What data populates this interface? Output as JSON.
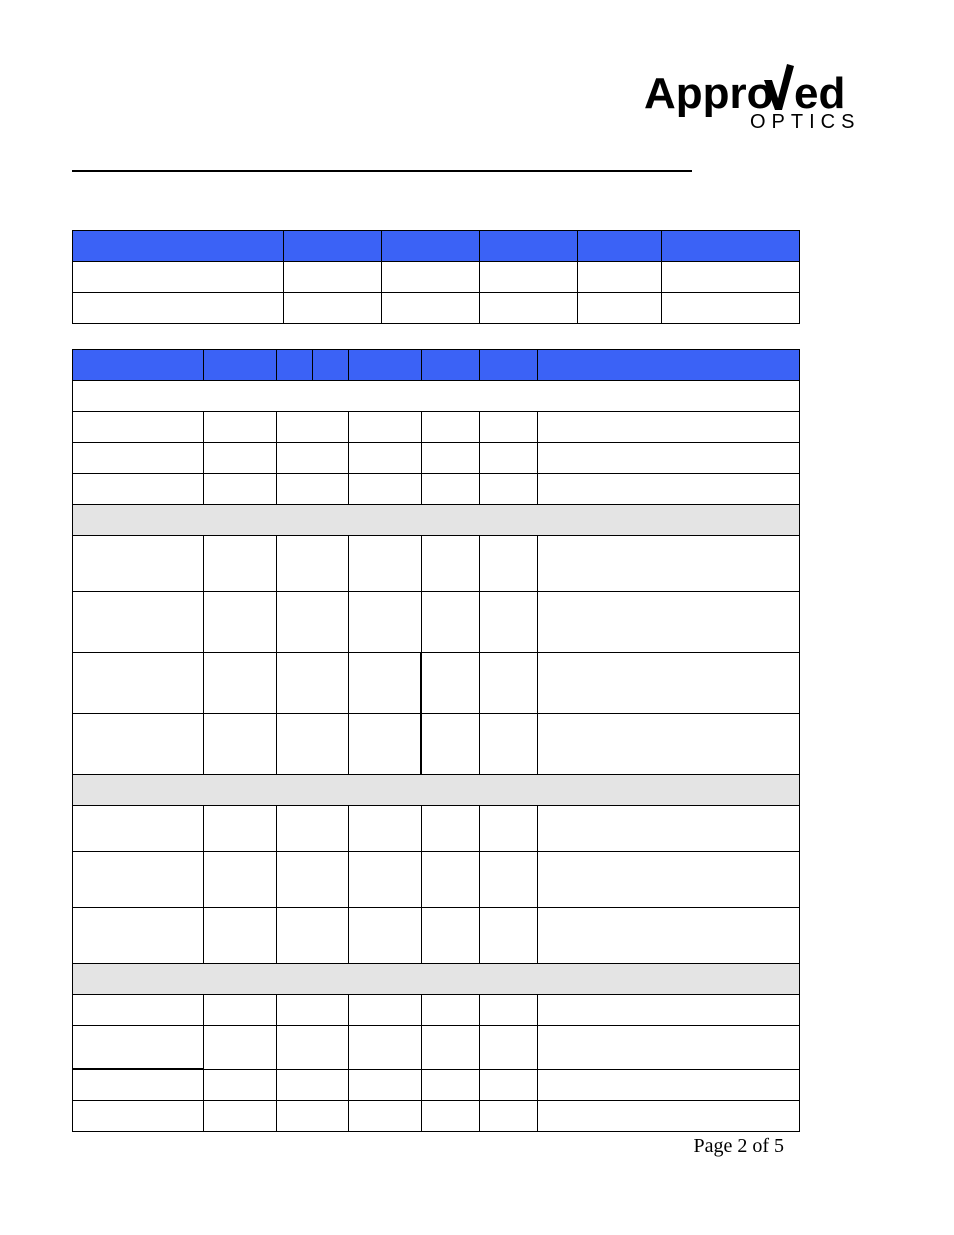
{
  "logo": {
    "line1": "Approved",
    "line2": "OPTICS"
  },
  "table1": {
    "headers": [
      "",
      "",
      "",
      "",
      "",
      ""
    ],
    "rows": [
      [
        "",
        "",
        "",
        "",
        "",
        ""
      ],
      [
        "",
        "",
        "",
        "",
        "",
        ""
      ]
    ]
  },
  "table2": {
    "headers": [
      "",
      "",
      "",
      "",
      "",
      "",
      "",
      ""
    ],
    "groups": [
      {
        "title": "",
        "rows": [
          [
            "",
            "",
            "",
            "",
            "",
            "",
            "",
            ""
          ],
          [
            "",
            "",
            "",
            "",
            "",
            "",
            "",
            ""
          ],
          [
            "",
            "",
            "",
            "",
            "",
            "",
            "",
            ""
          ]
        ]
      },
      {
        "title": "",
        "rows": [
          [
            "",
            "",
            "",
            "",
            "",
            "",
            "",
            ""
          ],
          [
            "",
            "",
            "",
            "",
            "",
            "",
            "",
            ""
          ],
          [
            "",
            "",
            "",
            "",
            "",
            "",
            "",
            ""
          ],
          [
            "",
            "",
            "",
            "",
            "",
            "",
            "",
            ""
          ]
        ]
      },
      {
        "title": "",
        "rows": [
          [
            "",
            "",
            "",
            "",
            "",
            "",
            "",
            ""
          ],
          [
            "",
            "",
            "",
            "",
            "",
            "",
            "",
            ""
          ],
          [
            "",
            "",
            "",
            "",
            "",
            "",
            "",
            ""
          ]
        ]
      },
      {
        "title": "",
        "rows": [
          [
            "",
            "",
            "",
            "",
            "",
            "",
            "",
            ""
          ],
          [
            "",
            "",
            "",
            "",
            "",
            "",
            "",
            ""
          ],
          [
            "",
            "",
            "",
            "",
            "",
            "",
            "",
            ""
          ],
          [
            "",
            "",
            "",
            "",
            "",
            "",
            "",
            ""
          ]
        ]
      }
    ]
  },
  "footer": "Page 2 of 5"
}
